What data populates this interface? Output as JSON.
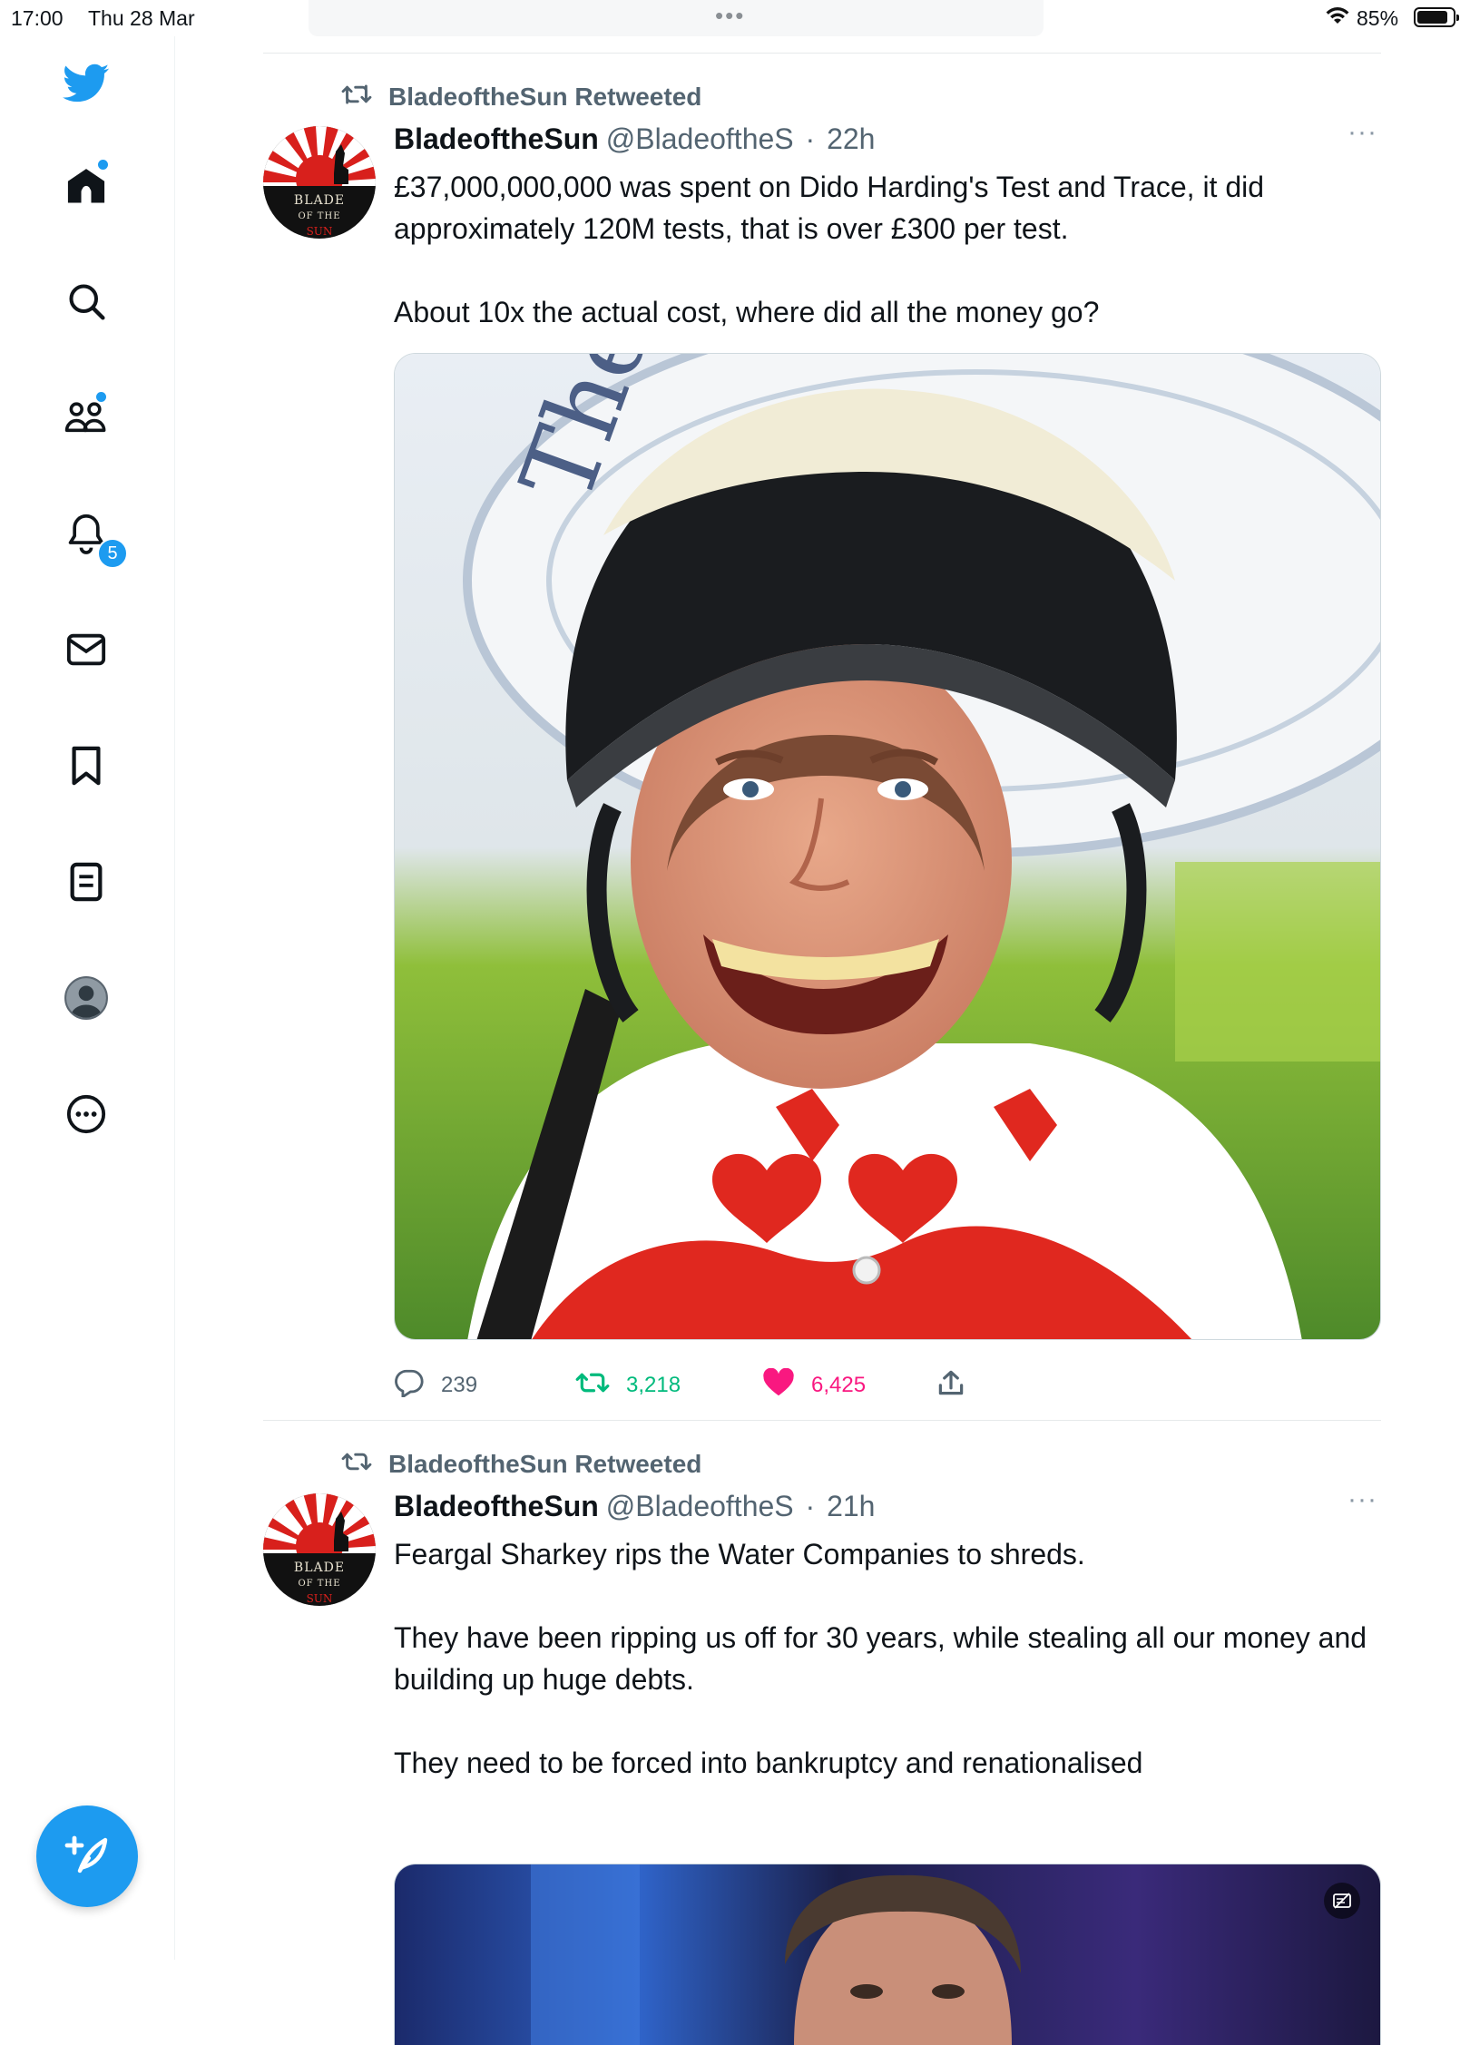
{
  "status_bar": {
    "time": "17:00",
    "date": "Thu 28 Mar",
    "more_dots": "•••",
    "battery_percent": "85%"
  },
  "sidebar": {
    "items": [
      {
        "name": "home",
        "icon": "home-icon",
        "has_dot": true
      },
      {
        "name": "explore",
        "icon": "search-icon"
      },
      {
        "name": "communities",
        "icon": "communities-icon",
        "has_dot": true
      },
      {
        "name": "notifications",
        "icon": "bell-icon",
        "badge": "5"
      },
      {
        "name": "messages",
        "icon": "mail-icon"
      },
      {
        "name": "bookmarks",
        "icon": "bookmark-icon"
      },
      {
        "name": "lists",
        "icon": "lists-icon"
      },
      {
        "name": "profile",
        "icon": "avatar-icon"
      },
      {
        "name": "more",
        "icon": "more-circle-icon"
      }
    ],
    "compose_icon": "compose-feather-icon",
    "brand_color": "#1d9bf0"
  },
  "tweets": [
    {
      "retweeted_by": "BladeoftheSun Retweeted",
      "name": "BladeoftheSun",
      "handle": "@BladeoftheS",
      "sep": "·",
      "time": "22h",
      "more": "···",
      "paragraphs": [
        "£37,000,000,000 was spent on Dido Harding's Test and Trace, it did approximately 120M tests, that is over £300 per test.",
        "About 10x the actual cost, where did all the money go?"
      ],
      "replies": "239",
      "retweets": "3,218",
      "likes": "6,425"
    },
    {
      "retweeted_by": "BladeoftheSun Retweeted",
      "name": "BladeoftheSun",
      "handle": "@BladeoftheS",
      "sep": "·",
      "time": "21h",
      "more": "···",
      "paragraphs": [
        "Feargal Sharkey rips the Water Companies to shreds.",
        "They have been ripping us off for 30 years, while stealing all our money and building up huge debts.",
        "They need to be forced into bankruptcy and renationalised"
      ]
    }
  ],
  "colors": {
    "retweet_green": "#00ba7c",
    "like_pink": "#f91880",
    "secondary_text": "#536471"
  }
}
